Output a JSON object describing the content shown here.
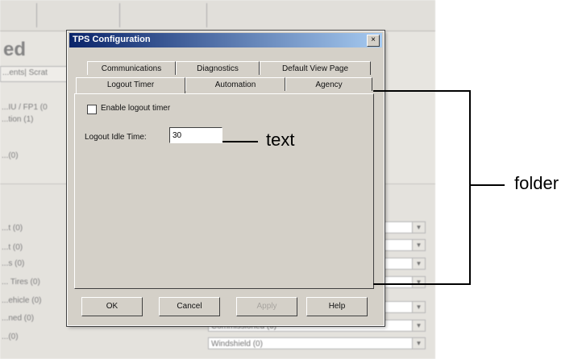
{
  "background": {
    "title_fragment": "ed",
    "tabs_fragment": "...ents| Scrat",
    "panel_lines": [
      "...IU / FP1 (0",
      "...tion (1)",
      "...(0)"
    ],
    "lower_list": [
      "...t (0)",
      "...t (0)",
      "...s (0)",
      "... Tires (0)",
      "...ehicle (0)",
      "...ned (0)",
      "...(0)"
    ],
    "dropdowns": [
      "",
      "",
      "",
      "",
      "",
      "Commissioned (0)",
      "Windshield (0)"
    ]
  },
  "dialog": {
    "title": "TPS Configuration",
    "close_glyph": "×",
    "tabs_row1": [
      "Communications",
      "Diagnostics",
      "Default View Page"
    ],
    "tabs_row2": [
      "Logout Timer",
      "Automation",
      "Agency"
    ],
    "active_tab": "Logout Timer",
    "enable_logout_timer": {
      "label": "Enable logout timer",
      "checked": false
    },
    "logout_idle_time": {
      "label": "Logout Idle Time:",
      "value": "30"
    },
    "buttons": {
      "ok": "OK",
      "cancel": "Cancel",
      "apply": "Apply",
      "help": "Help"
    }
  },
  "annotations": {
    "text": "text",
    "folder": "folder"
  }
}
